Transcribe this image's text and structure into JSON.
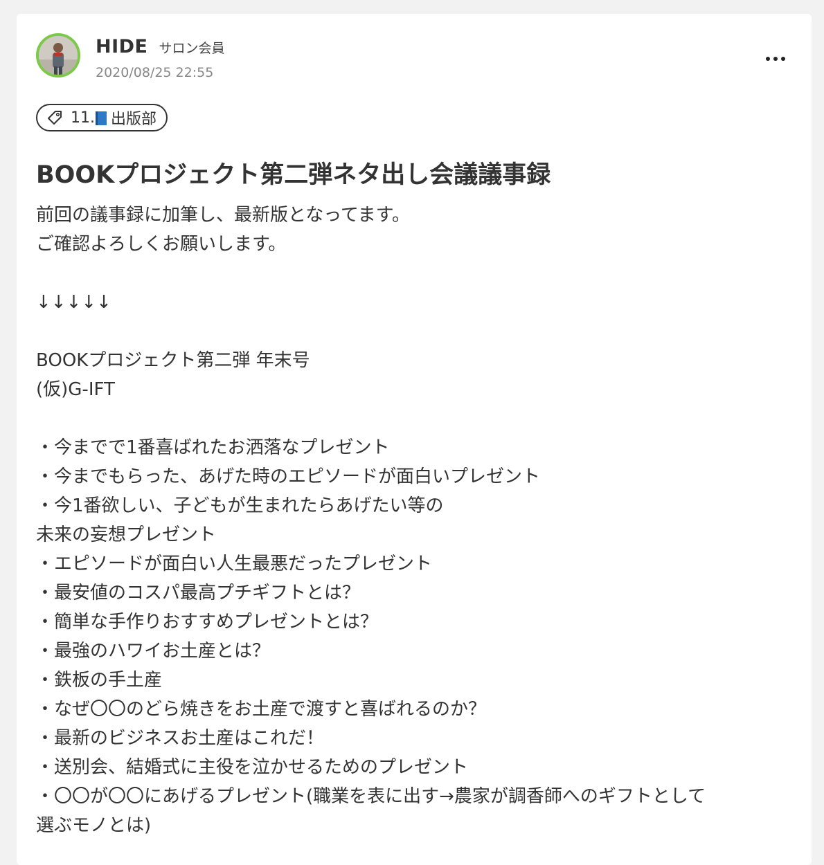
{
  "post": {
    "author": {
      "name": "HIDE",
      "role": "サロン会員",
      "avatar": "avatar-photo"
    },
    "timestamp": "2020/08/25 22:55",
    "menu_icon": "more-horizontal-icon",
    "tag": {
      "icon": "tag-icon",
      "prefix": "11.",
      "emoji": "blue-book-icon",
      "label": "出版部"
    },
    "title": "BOOKプロジェクト第二弾ネタ出し会議議事録",
    "body": {
      "intro_1": "前回の議事録に加筆し、最新版となってます。",
      "intro_2": "ご確認よろしくお願いします。",
      "arrows": "↓↓↓↓↓",
      "project_title": "BOOKプロジェクト第二弾 年末号",
      "project_subtitle": "(仮)G-IFT",
      "items": [
        "・今までで1番喜ばれたお洒落なプレゼント",
        "・今までもらった、あげた時のエピソードが面白いプレゼント",
        "・今1番欲しい、子どもが生まれたらあげたい等の",
        "未来の妄想プレゼント",
        "・エピソードが面白い人生最悪だったプレゼント",
        "・最安値のコスパ最高プチギフトとは？",
        "・簡単な手作りおすすめプレゼントとは？",
        "・最強のハワイお土産とは？",
        "・鉄板の手土産",
        "・なぜ〇〇のどら焼きをお土産で渡すと喜ばれるのか？",
        "・最新のビジネスお土産はこれだ！",
        "・送別会、結婚式に主役を泣かせるためのプレゼント",
        "・〇〇が〇〇にあげるプレゼント(職業を表に出す→農家が調香師へのギフトとして",
        "選ぶモノとは)"
      ]
    },
    "colors": {
      "avatar_ring": "#7cc94a",
      "text": "#333333",
      "muted": "#888888"
    }
  }
}
